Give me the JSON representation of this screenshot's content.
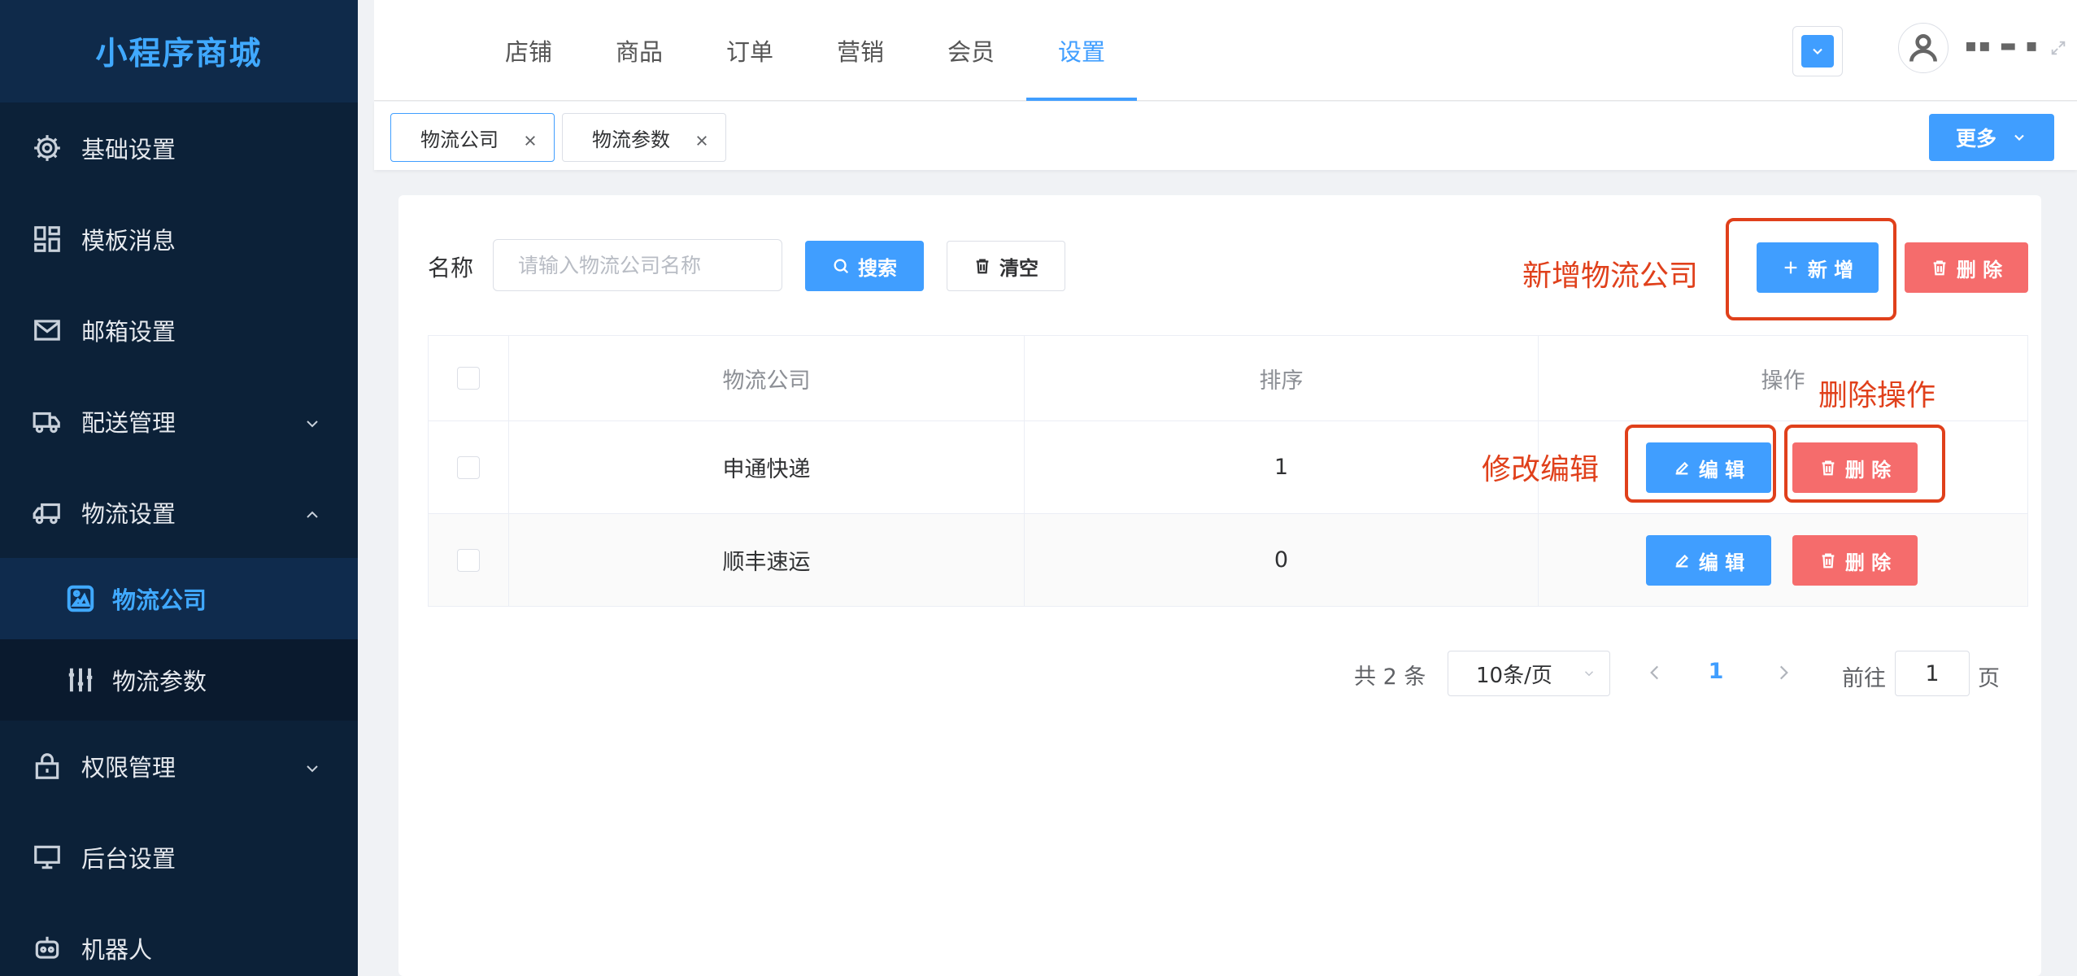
{
  "app": {
    "title": "小程序商城"
  },
  "sidebar": {
    "items": [
      {
        "label": "基础设置",
        "icon": "gear-icon"
      },
      {
        "label": "模板消息",
        "icon": "grid-icon"
      },
      {
        "label": "邮箱设置",
        "icon": "mail-icon"
      },
      {
        "label": "配送管理",
        "icon": "delivery-icon",
        "expandable": true
      },
      {
        "label": "物流设置",
        "icon": "truck-icon",
        "expanded": true
      },
      {
        "label": "权限管理",
        "icon": "lock-icon",
        "expandable": true
      },
      {
        "label": "后台设置",
        "icon": "monitor-icon"
      },
      {
        "label": "机器人",
        "icon": "robot-icon"
      }
    ],
    "submenu": [
      {
        "label": "物流公司",
        "icon": "image-icon",
        "active": true
      },
      {
        "label": "物流参数",
        "icon": "sliders-icon"
      }
    ]
  },
  "topnav": {
    "items": [
      "店铺",
      "商品",
      "订单",
      "营销",
      "会员",
      "设置"
    ],
    "active": "设置"
  },
  "user": {
    "name": "▪▪ ▬ ▪"
  },
  "tabs": [
    {
      "label": "物流公司",
      "active": true
    },
    {
      "label": "物流参数",
      "active": false
    }
  ],
  "more_label": "更多",
  "search": {
    "label": "名称",
    "placeholder": "请输入物流公司名称",
    "search_label": "搜索",
    "clear_label": "清空"
  },
  "toolbar": {
    "add_label": "新 增",
    "delete_label": "删 除"
  },
  "table": {
    "headers": [
      "物流公司",
      "排序",
      "操作"
    ],
    "rows": [
      {
        "company": "申通快递",
        "sort": "1"
      },
      {
        "company": "顺丰速运",
        "sort": "0"
      }
    ],
    "edit_label": "编 辑",
    "delete_label": "删 除"
  },
  "annotations": {
    "add": "新增物流公司",
    "edit": "修改编辑",
    "delete": "删除操作"
  },
  "pagination": {
    "total": "共 2 条",
    "page_size": "10条/页",
    "current": "1",
    "goto_label": "前往",
    "goto_value": "1",
    "page_suffix": "页"
  },
  "colors": {
    "primary": "#409eff",
    "danger": "#f56c6c",
    "sidebar": "#0c2138",
    "annotation": "#e0401b"
  }
}
